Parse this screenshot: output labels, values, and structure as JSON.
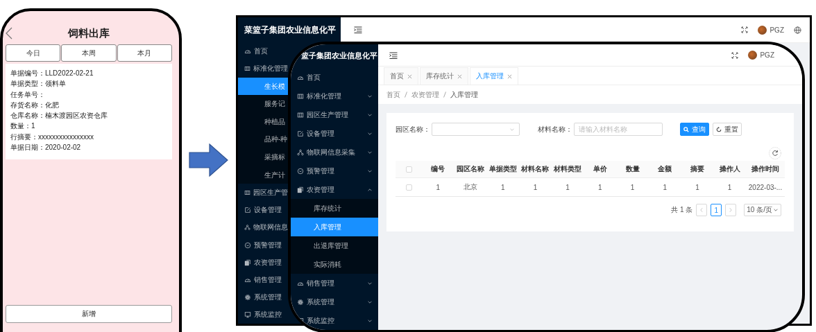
{
  "phone": {
    "title": "饲料出库",
    "tabs": [
      "今日",
      "本周",
      "本月"
    ],
    "fields": [
      {
        "label": "单据编号：",
        "value": "LLD2022-02-21"
      },
      {
        "label": "单据类型：",
        "value": "领料单"
      },
      {
        "label": "任务单号："
      },
      {
        "label": "存货名称：",
        "value": "化肥"
      },
      {
        "label": "仓库名称：",
        "value": "楠木渡园区农资仓库"
      },
      {
        "label": "数量：",
        "value": "1"
      },
      {
        "label": "行摘要：",
        "value": "xxxxxxxxxxxxxxxx"
      },
      {
        "label": "单据日期：",
        "value": "2020-02-02"
      }
    ],
    "add_button": "新增"
  },
  "back_window": {
    "title": "菜篮子集团农业信息化平",
    "user": "PGZ",
    "sidebar": [
      {
        "label": "首页",
        "selected": false
      },
      {
        "label": "标准化管理",
        "selected": false,
        "children": [
          {
            "label": "生长模",
            "selected": true
          },
          {
            "label": "服务记",
            "selected": false
          },
          {
            "label": "种植品",
            "selected": false
          },
          {
            "label": "品种-种",
            "selected": false
          },
          {
            "label": "采摘标",
            "selected": false
          },
          {
            "label": "生产计",
            "selected": false
          }
        ]
      },
      {
        "label": "园区生产管",
        "selected": false
      },
      {
        "label": "设备管理",
        "selected": false
      },
      {
        "label": "物联网信息",
        "selected": false
      },
      {
        "label": "预警管理",
        "selected": false
      },
      {
        "label": "农资管理",
        "selected": false
      },
      {
        "label": "销售管理",
        "selected": false
      },
      {
        "label": "系统管理",
        "selected": false
      },
      {
        "label": "系统监控",
        "selected": false
      }
    ]
  },
  "front_window": {
    "title": "篮子集团农业信息化平",
    "user": "PGZ",
    "sidebar": [
      {
        "label": "首页",
        "selected": false
      },
      {
        "label": "标准化管理",
        "selected": false,
        "expanded": false
      },
      {
        "label": "园区生产管理",
        "selected": false,
        "expanded": false
      },
      {
        "label": "设备管理",
        "selected": false,
        "expanded": false
      },
      {
        "label": "物联网信息采集",
        "selected": false,
        "expanded": false
      },
      {
        "label": "预警管理",
        "selected": false,
        "expanded": false
      },
      {
        "label": "农资管理",
        "selected": false,
        "expanded": true,
        "children": [
          {
            "label": "库存统计",
            "selected": false
          },
          {
            "label": "入库管理",
            "selected": true
          },
          {
            "label": "出退库管理",
            "selected": false
          },
          {
            "label": "实际消耗",
            "selected": false
          }
        ]
      },
      {
        "label": "销售管理",
        "selected": false,
        "expanded": false
      },
      {
        "label": "系统管理",
        "selected": false,
        "expanded": false
      },
      {
        "label": "系统监控",
        "selected": false,
        "expanded": false
      }
    ],
    "tabs": [
      {
        "label": "首页",
        "selected": false
      },
      {
        "label": "库存统计",
        "selected": false
      },
      {
        "label": "入库管理",
        "selected": true
      }
    ],
    "breadcrumb": [
      "首页",
      "农资管理",
      "入库管理"
    ],
    "filters": [
      {
        "label": "园区名称：",
        "kind": "select"
      },
      {
        "label": "材料名称：",
        "kind": "input",
        "placeholder": "请输入材料名称"
      }
    ],
    "buttons": [
      {
        "label": "查询",
        "kind": "primary"
      },
      {
        "label": "重置",
        "kind": "default"
      }
    ],
    "table": {
      "all_checked": false,
      "columns": [
        "编号",
        "园区名称",
        "单据类型",
        "材料名称",
        "材料类型",
        "单价",
        "数量",
        "金额",
        "摘要",
        "操作人",
        "操作时间"
      ],
      "rows": [
        {
          "checked": false,
          "cells": [
            "1",
            "北京",
            "1",
            "1",
            "1",
            "1",
            "1",
            "1",
            "1",
            "1",
            "2022-03-..."
          ]
        }
      ]
    },
    "pagination": {
      "total": "共 1 条",
      "pages": [
        {
          "label": "1",
          "selected": true
        }
      ],
      "page_size": "10 条/页"
    }
  }
}
